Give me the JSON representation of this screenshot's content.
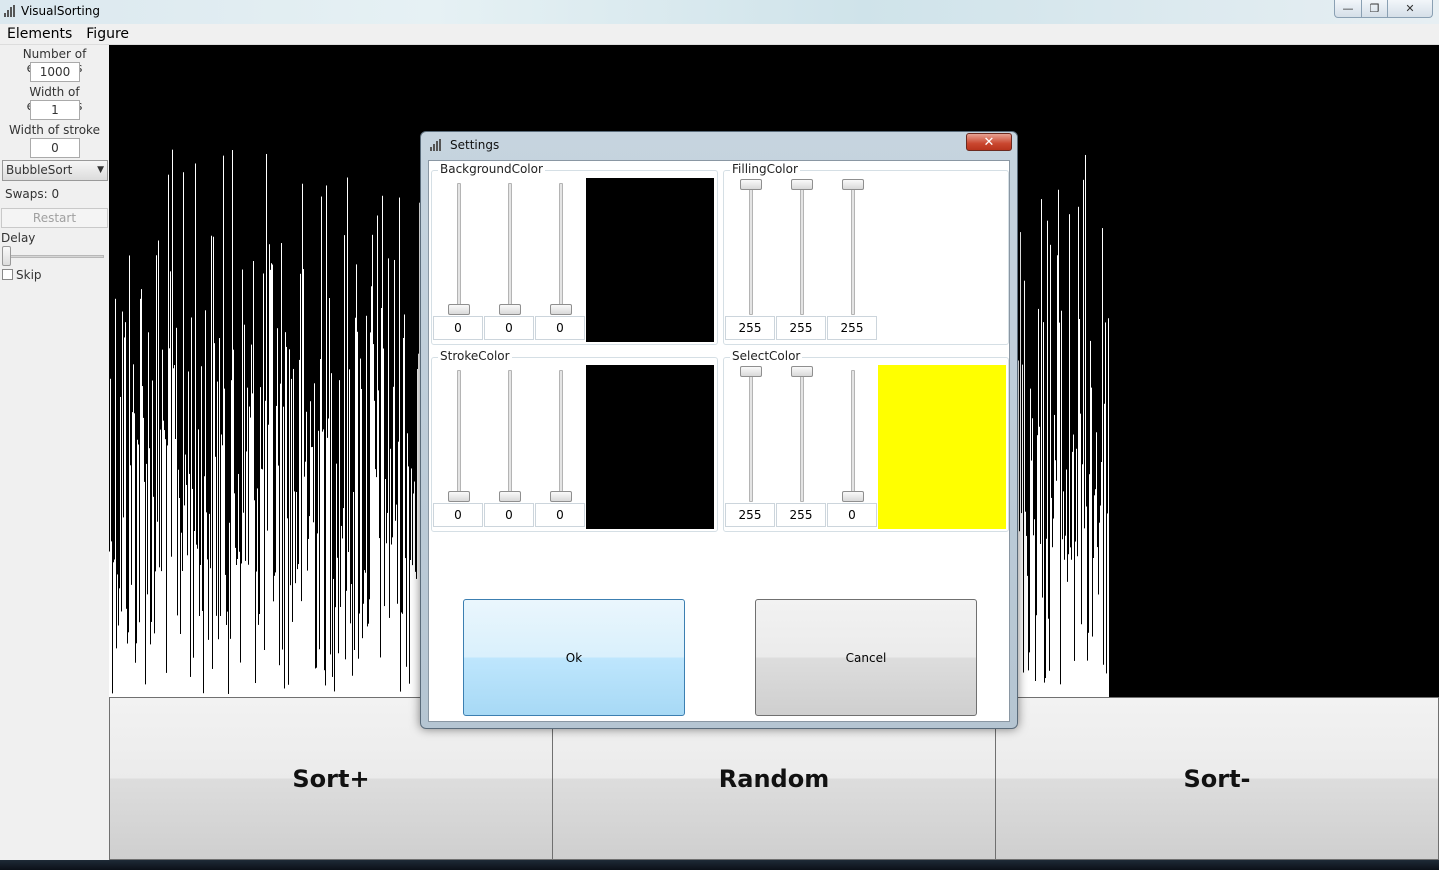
{
  "window": {
    "title": "VisualSorting",
    "min_glyph": "—",
    "max_glyph": "❐",
    "close_glyph": "✕"
  },
  "menu": [
    "Elements",
    "Figure"
  ],
  "left_panel": {
    "num_elements_label": "Number of elements",
    "num_elements_value": "1000",
    "width_elements_label": "Width of elements",
    "width_elements_value": "1",
    "width_stroke_label": "Width of stroke",
    "width_stroke_value": "0",
    "algorithm_selected": "BubbleSort",
    "swaps_text": "Swaps: 0",
    "restart_label": "Restart",
    "delay_label": "Delay",
    "delay_level": 0,
    "skip_label": "Skip",
    "skip_checked": false
  },
  "bottom_buttons": {
    "sort_plus": "Sort+",
    "random": "Random",
    "sort_minus": "Sort-"
  },
  "dialog": {
    "title": "Settings",
    "close_glyph": "✕",
    "background_color": {
      "label": "BackgroundColor",
      "r": "0",
      "g": "0",
      "b": "0",
      "swatch": "#000000"
    },
    "filling_color": {
      "label": "FillingColor",
      "r": "255",
      "g": "255",
      "b": "255",
      "swatch": "#ffffff"
    },
    "stroke_color": {
      "label": "StrokeColor",
      "r": "0",
      "g": "0",
      "b": "0",
      "swatch": "#000000"
    },
    "select_color": {
      "label": "SelectColor",
      "r": "255",
      "g": "255",
      "b": "0",
      "swatch": "#ffff00"
    },
    "ok_label": "Ok",
    "cancel_label": "Cancel"
  },
  "colors": {
    "canvas_background": "#000000",
    "bar_fill": "#ffffff",
    "ok_accent": "#3c7fb1"
  }
}
